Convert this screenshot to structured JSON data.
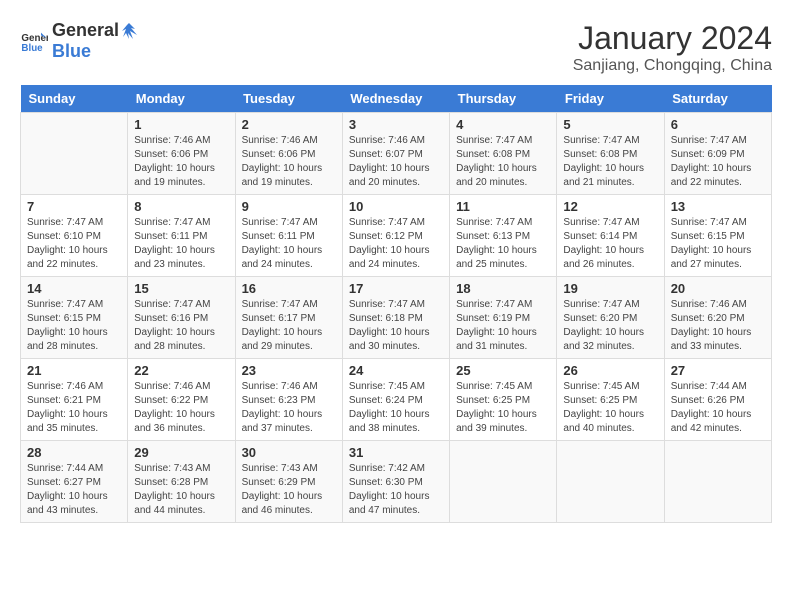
{
  "logo": {
    "general": "General",
    "blue": "Blue"
  },
  "title": "January 2024",
  "location": "Sanjiang, Chongqing, China",
  "days_of_week": [
    "Sunday",
    "Monday",
    "Tuesday",
    "Wednesday",
    "Thursday",
    "Friday",
    "Saturday"
  ],
  "weeks": [
    [
      {
        "day": "",
        "info": ""
      },
      {
        "day": "1",
        "info": "Sunrise: 7:46 AM\nSunset: 6:06 PM\nDaylight: 10 hours\nand 19 minutes."
      },
      {
        "day": "2",
        "info": "Sunrise: 7:46 AM\nSunset: 6:06 PM\nDaylight: 10 hours\nand 19 minutes."
      },
      {
        "day": "3",
        "info": "Sunrise: 7:46 AM\nSunset: 6:07 PM\nDaylight: 10 hours\nand 20 minutes."
      },
      {
        "day": "4",
        "info": "Sunrise: 7:47 AM\nSunset: 6:08 PM\nDaylight: 10 hours\nand 20 minutes."
      },
      {
        "day": "5",
        "info": "Sunrise: 7:47 AM\nSunset: 6:08 PM\nDaylight: 10 hours\nand 21 minutes."
      },
      {
        "day": "6",
        "info": "Sunrise: 7:47 AM\nSunset: 6:09 PM\nDaylight: 10 hours\nand 22 minutes."
      }
    ],
    [
      {
        "day": "7",
        "info": "Sunrise: 7:47 AM\nSunset: 6:10 PM\nDaylight: 10 hours\nand 22 minutes."
      },
      {
        "day": "8",
        "info": "Sunrise: 7:47 AM\nSunset: 6:11 PM\nDaylight: 10 hours\nand 23 minutes."
      },
      {
        "day": "9",
        "info": "Sunrise: 7:47 AM\nSunset: 6:11 PM\nDaylight: 10 hours\nand 24 minutes."
      },
      {
        "day": "10",
        "info": "Sunrise: 7:47 AM\nSunset: 6:12 PM\nDaylight: 10 hours\nand 24 minutes."
      },
      {
        "day": "11",
        "info": "Sunrise: 7:47 AM\nSunset: 6:13 PM\nDaylight: 10 hours\nand 25 minutes."
      },
      {
        "day": "12",
        "info": "Sunrise: 7:47 AM\nSunset: 6:14 PM\nDaylight: 10 hours\nand 26 minutes."
      },
      {
        "day": "13",
        "info": "Sunrise: 7:47 AM\nSunset: 6:15 PM\nDaylight: 10 hours\nand 27 minutes."
      }
    ],
    [
      {
        "day": "14",
        "info": "Sunrise: 7:47 AM\nSunset: 6:15 PM\nDaylight: 10 hours\nand 28 minutes."
      },
      {
        "day": "15",
        "info": "Sunrise: 7:47 AM\nSunset: 6:16 PM\nDaylight: 10 hours\nand 28 minutes."
      },
      {
        "day": "16",
        "info": "Sunrise: 7:47 AM\nSunset: 6:17 PM\nDaylight: 10 hours\nand 29 minutes."
      },
      {
        "day": "17",
        "info": "Sunrise: 7:47 AM\nSunset: 6:18 PM\nDaylight: 10 hours\nand 30 minutes."
      },
      {
        "day": "18",
        "info": "Sunrise: 7:47 AM\nSunset: 6:19 PM\nDaylight: 10 hours\nand 31 minutes."
      },
      {
        "day": "19",
        "info": "Sunrise: 7:47 AM\nSunset: 6:20 PM\nDaylight: 10 hours\nand 32 minutes."
      },
      {
        "day": "20",
        "info": "Sunrise: 7:46 AM\nSunset: 6:20 PM\nDaylight: 10 hours\nand 33 minutes."
      }
    ],
    [
      {
        "day": "21",
        "info": "Sunrise: 7:46 AM\nSunset: 6:21 PM\nDaylight: 10 hours\nand 35 minutes."
      },
      {
        "day": "22",
        "info": "Sunrise: 7:46 AM\nSunset: 6:22 PM\nDaylight: 10 hours\nand 36 minutes."
      },
      {
        "day": "23",
        "info": "Sunrise: 7:46 AM\nSunset: 6:23 PM\nDaylight: 10 hours\nand 37 minutes."
      },
      {
        "day": "24",
        "info": "Sunrise: 7:45 AM\nSunset: 6:24 PM\nDaylight: 10 hours\nand 38 minutes."
      },
      {
        "day": "25",
        "info": "Sunrise: 7:45 AM\nSunset: 6:25 PM\nDaylight: 10 hours\nand 39 minutes."
      },
      {
        "day": "26",
        "info": "Sunrise: 7:45 AM\nSunset: 6:25 PM\nDaylight: 10 hours\nand 40 minutes."
      },
      {
        "day": "27",
        "info": "Sunrise: 7:44 AM\nSunset: 6:26 PM\nDaylight: 10 hours\nand 42 minutes."
      }
    ],
    [
      {
        "day": "28",
        "info": "Sunrise: 7:44 AM\nSunset: 6:27 PM\nDaylight: 10 hours\nand 43 minutes."
      },
      {
        "day": "29",
        "info": "Sunrise: 7:43 AM\nSunset: 6:28 PM\nDaylight: 10 hours\nand 44 minutes."
      },
      {
        "day": "30",
        "info": "Sunrise: 7:43 AM\nSunset: 6:29 PM\nDaylight: 10 hours\nand 46 minutes."
      },
      {
        "day": "31",
        "info": "Sunrise: 7:42 AM\nSunset: 6:30 PM\nDaylight: 10 hours\nand 47 minutes."
      },
      {
        "day": "",
        "info": ""
      },
      {
        "day": "",
        "info": ""
      },
      {
        "day": "",
        "info": ""
      }
    ]
  ]
}
